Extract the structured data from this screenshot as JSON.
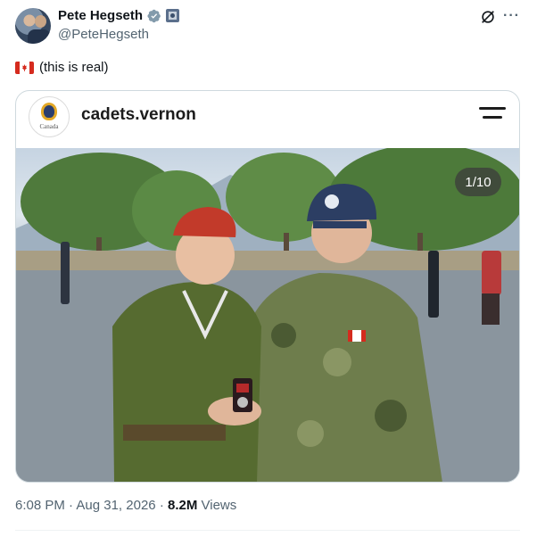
{
  "author": {
    "display_name": "Pete Hegseth",
    "handle": "@PeteHegseth",
    "verified_icon": "verified-badge-icon",
    "affiliation_icon": "affiliation-flag-icon"
  },
  "tweet": {
    "flag_emoji": "canada-flag-icon",
    "text": "(this is real)"
  },
  "embed": {
    "account_name": "cadets.vernon",
    "badge_text": "Canada",
    "image_counter": "1/10",
    "image_description_icon": "photo"
  },
  "meta": {
    "time": "6:08 PM",
    "separator": "·",
    "date": "Aug 31, 2026",
    "views_count": "8.2M",
    "views_label": "Views"
  },
  "colors": {
    "text_primary": "#0f1419",
    "text_secondary": "#536471",
    "verified_blue": "#1d9bf0",
    "border": "#cfd9de"
  }
}
